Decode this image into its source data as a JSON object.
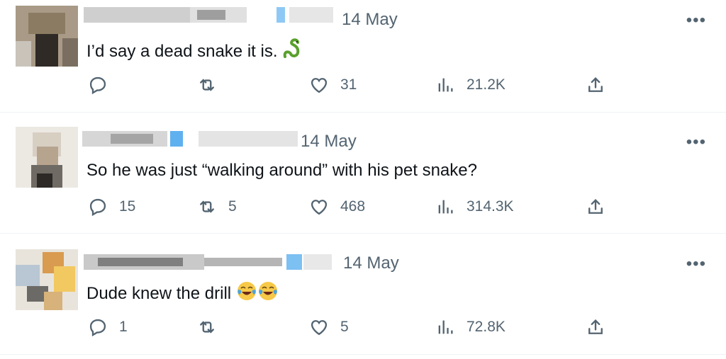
{
  "replies": [
    {
      "date": "14 May",
      "text": "I’d say a dead snake it is.",
      "emoji": [
        "snake-emoji"
      ],
      "reply_count": "",
      "retweet_count": "",
      "like_count": "31",
      "view_count": "21.2K"
    },
    {
      "date": "14 May",
      "text": "So he was just “walking around” with his pet snake?",
      "emoji": [],
      "reply_count": "15",
      "retweet_count": "5",
      "like_count": "468",
      "view_count": "314.3K"
    },
    {
      "date": "14 May",
      "text": "Dude knew the drill",
      "emoji": [
        "tears-of-joy-emoji",
        "tears-of-joy-emoji"
      ],
      "reply_count": "1",
      "retweet_count": "",
      "like_count": "5",
      "view_count": "72.8K"
    }
  ],
  "more_label": "•••",
  "colors": {
    "icon_gray": "#536471",
    "text": "#0f1419",
    "divider": "#eff3f4",
    "verified_blue": "#1d9bf0"
  }
}
